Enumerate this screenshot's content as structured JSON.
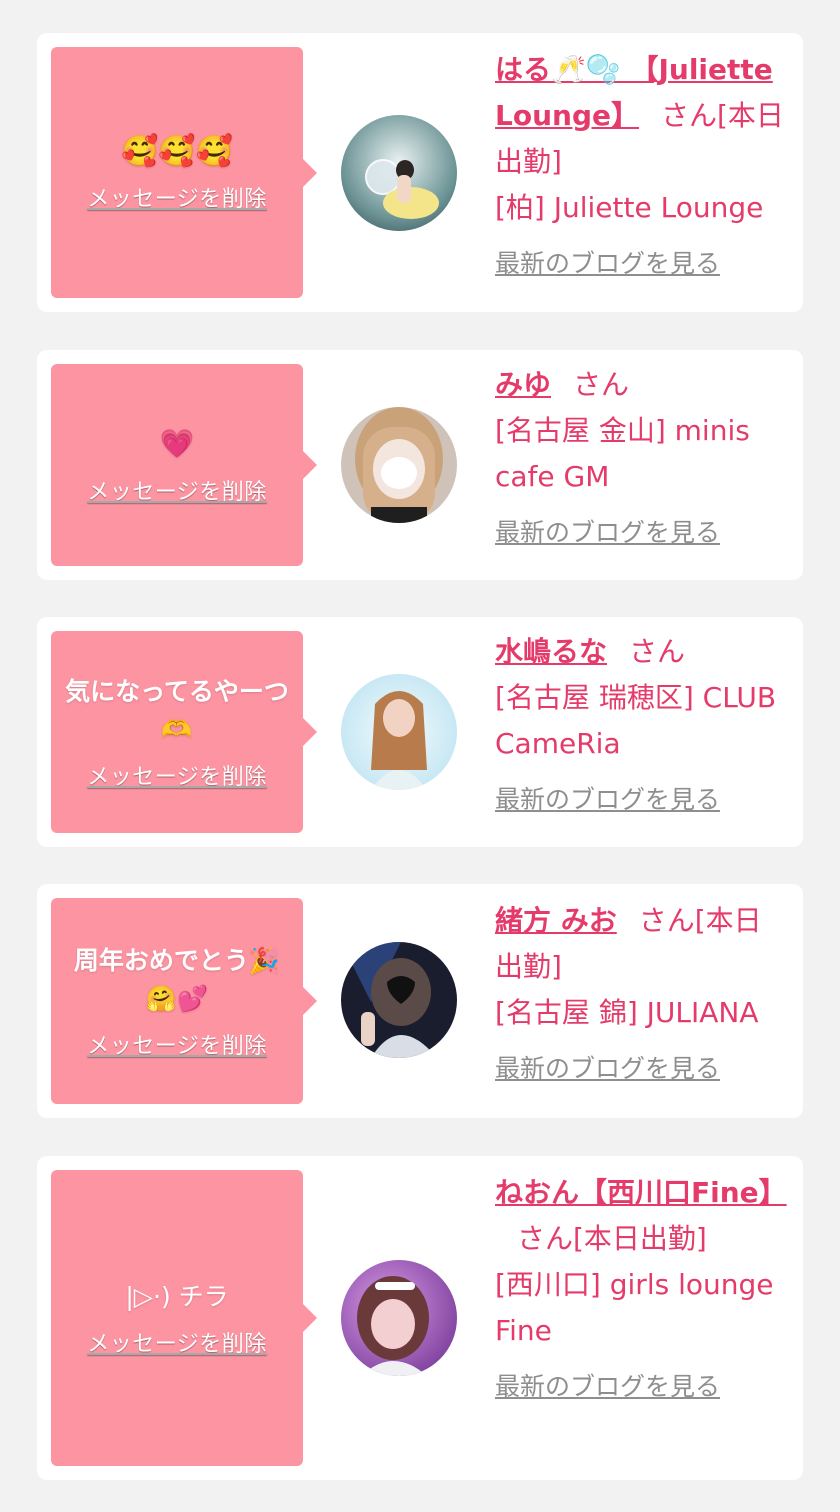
{
  "ui": {
    "delete_label": "メッセージを削除",
    "blog_label": "最新のブログを見る",
    "san_suffix": "さん"
  },
  "cards": [
    {
      "message": "🥰🥰🥰",
      "name": "はる🥂🫧 【Juliette Lounge】",
      "suffix": "さん[本日出勤]",
      "shop": "[柏] Juliette Lounge"
    },
    {
      "message": "💗",
      "name": "みゆ",
      "suffix": "さん",
      "shop": "[名古屋 金山] minis cafe GM"
    },
    {
      "message": "気になってるやーつ🫶",
      "name": "水嶋るな",
      "suffix": "さん",
      "shop": "[名古屋 瑞穂区] CLUB CameRia"
    },
    {
      "message": "周年おめでとう🎉🤗💕",
      "name": "緒方 みお",
      "suffix": "さん[本日出勤]",
      "shop": "[名古屋 錦] JULIANA"
    },
    {
      "message": "|▷·) チラ",
      "name": "ねおん【西川口Fine】",
      "suffix": "さん[本日出勤]",
      "shop": "[西川口] girls lounge Fine"
    }
  ],
  "colors": {
    "page_bg": "#f2f2f2",
    "card_bg": "#ffffff",
    "bubble_bg": "#fd94a2",
    "accent_text": "#e43b6a",
    "link_gray": "#8e8e8e"
  }
}
